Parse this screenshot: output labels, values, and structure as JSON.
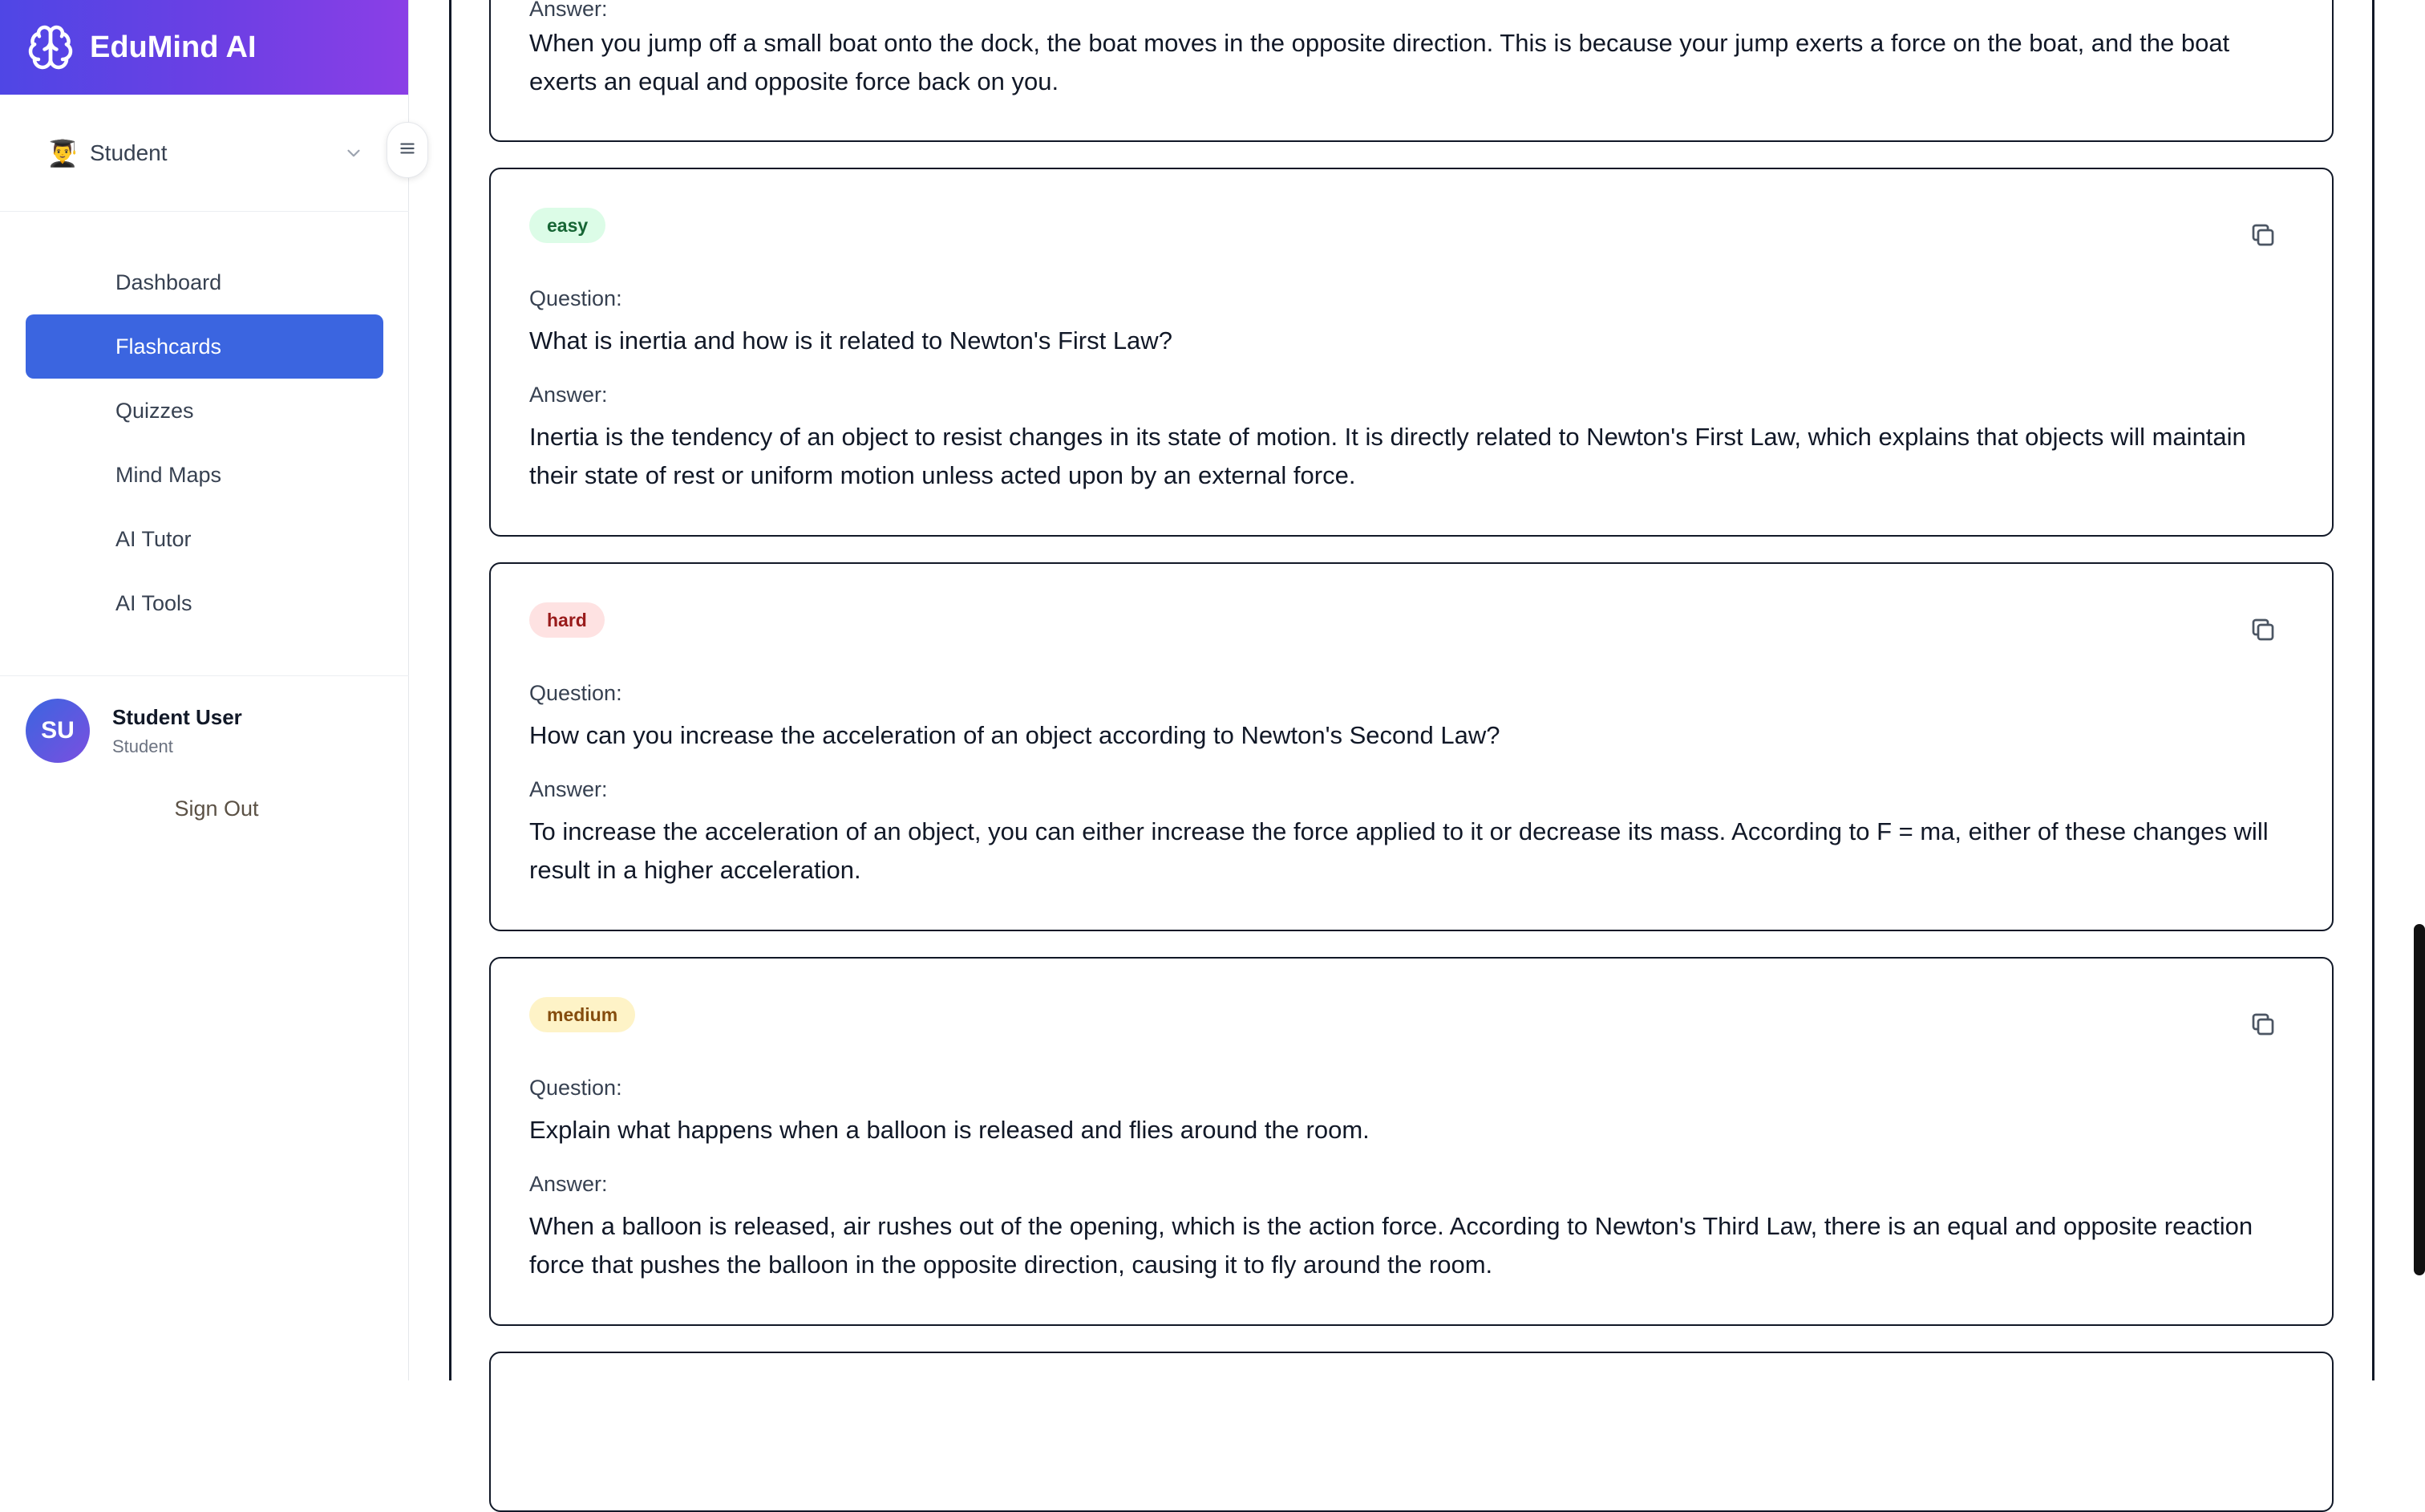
{
  "brand": {
    "title": "EduMind AI"
  },
  "role_selector": {
    "emoji": "👨‍🎓",
    "label": "Student"
  },
  "nav": {
    "items": [
      {
        "label": "Dashboard",
        "active": false
      },
      {
        "label": "Flashcards",
        "active": true
      },
      {
        "label": "Quizzes",
        "active": false
      },
      {
        "label": "Mind Maps",
        "active": false
      },
      {
        "label": "AI Tutor",
        "active": false
      },
      {
        "label": "AI Tools",
        "active": false
      }
    ]
  },
  "user": {
    "initials": "SU",
    "name": "Student User",
    "role": "Student",
    "signout_label": "Sign Out"
  },
  "labels": {
    "question": "Question:",
    "answer": "Answer:"
  },
  "flashcards": [
    {
      "difficulty": "",
      "question": "",
      "answer": "When you jump off a small boat onto the dock, the boat moves in the opposite direction. This is because your jump exerts a force on the boat, and the boat exerts an equal and opposite force back on you."
    },
    {
      "difficulty": "easy",
      "question": "What is inertia and how is it related to Newton's First Law?",
      "answer": "Inertia is the tendency of an object to resist changes in its state of motion. It is directly related to Newton's First Law, which explains that objects will maintain their state of rest or uniform motion unless acted upon by an external force."
    },
    {
      "difficulty": "hard",
      "question": "How can you increase the acceleration of an object according to Newton's Second Law?",
      "answer": "To increase the acceleration of an object, you can either increase the force applied to it or decrease its mass. According to F = ma, either of these changes will result in a higher acceleration."
    },
    {
      "difficulty": "medium",
      "question": "Explain what happens when a balloon is released and flies around the room.",
      "answer": "When a balloon is released, air rushes out of the opening, which is the action force. According to Newton's Third Law, there is an equal and opposite reaction force that pushes the balloon in the opposite direction, causing it to fly around the room."
    }
  ],
  "icons": {
    "brand": "brain-icon",
    "chevron": "chevron-down-icon",
    "menu": "menu-icon",
    "copy": "copy-icon"
  },
  "colors": {
    "brand_gradient_start": "#4f46e5",
    "brand_gradient_end": "#8b3fe6",
    "active_nav": "#3b65e0",
    "easy_badge": "#dcfce7",
    "hard_badge": "#fee2e2",
    "medium_badge": "#fef3c7"
  }
}
